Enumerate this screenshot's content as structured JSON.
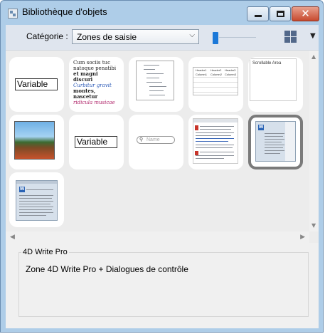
{
  "window": {
    "title": "Bibliothèque d'objets",
    "close_glyph": "✕"
  },
  "toolbar": {
    "category_label": "Catégorie :",
    "category_value": "Zones de saisie",
    "zoom_slider": 0.1,
    "view_icon": "windows-logo-icon"
  },
  "tiles": [
    {
      "name": "tile-variable",
      "label": "Variable"
    },
    {
      "name": "tile-rich-text",
      "lines": [
        "Cum sociis tuc",
        "natoque penatibi",
        "et magni discuri",
        "Curbitur gravit",
        "montes, nascetur",
        "ridicula musicae"
      ]
    },
    {
      "name": "tile-hierarchical-list"
    },
    {
      "name": "tile-listbox",
      "headers": [
        "Header1",
        "Header2",
        "Header3"
      ],
      "columns": [
        "Column1",
        "Column2",
        "Column3"
      ]
    },
    {
      "name": "tile-scrollable-area",
      "label": "Scrollable Area"
    },
    {
      "name": "tile-picture"
    },
    {
      "name": "tile-variable-2",
      "label": "Variable"
    },
    {
      "name": "tile-search-field",
      "placeholder": "Name"
    },
    {
      "name": "tile-4d-write"
    },
    {
      "name": "tile-4d-write-pro",
      "selected": true
    },
    {
      "name": "tile-4d-write-pro-dialogs"
    }
  ],
  "details": {
    "group_title": "4D Write Pro",
    "description": "Zone 4D Write Pro + Dialogues de contrôle"
  },
  "colors": {
    "accent": "#1b78d8",
    "selection_border": "#7a7a7a",
    "title_bar": "#aecde8"
  }
}
